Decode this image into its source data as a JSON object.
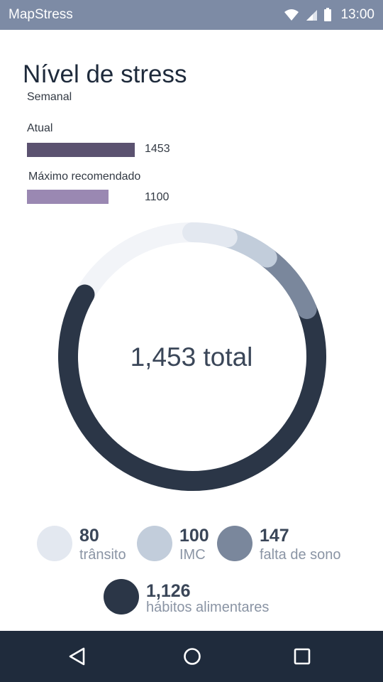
{
  "statusbar": {
    "app_name": "MapStress",
    "time": "13:00",
    "icons": [
      "wifi-icon",
      "cell-signal-icon",
      "battery-icon"
    ]
  },
  "page": {
    "title": "Nível de stress",
    "period": "Semanal"
  },
  "bars": [
    {
      "label": "Atual",
      "value": 1453,
      "value_text": "1453",
      "color": "#5b5270"
    },
    {
      "label": "Máximo recomendado",
      "value": 1100,
      "value_text": "1100",
      "color": "#9a88b2"
    }
  ],
  "chart_data": {
    "type": "pie",
    "total_text": "1,453 total",
    "total": 1453,
    "slices": [
      {
        "label": "trânsito",
        "value": 80,
        "value_text": "80",
        "color": "#e3e8f0"
      },
      {
        "label": "IMC",
        "value": 100,
        "value_text": "100",
        "color": "#c2cddb"
      },
      {
        "label": "falta de sono",
        "value": 147,
        "value_text": "147",
        "color": "#7a879c"
      },
      {
        "label": "hábitos alimentares",
        "value": 1126,
        "value_text": "1,126",
        "color": "#2b3647"
      }
    ],
    "track_color": "#f2f4f8"
  },
  "navbar": {
    "icons": [
      "back-icon",
      "home-icon",
      "recents-icon"
    ]
  }
}
